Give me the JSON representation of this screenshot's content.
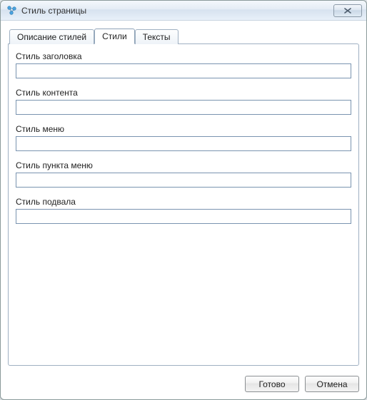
{
  "window": {
    "title": "Стиль страницы"
  },
  "tabs": [
    {
      "label": "Описание стилей",
      "active": false
    },
    {
      "label": "Стили",
      "active": true
    },
    {
      "label": "Тексты",
      "active": false
    }
  ],
  "fields": {
    "title_style": {
      "label": "Стиль заголовка",
      "value": ""
    },
    "content_style": {
      "label": "Стиль контента",
      "value": ""
    },
    "menu_style": {
      "label": "Стиль меню",
      "value": ""
    },
    "menuitem_style": {
      "label": "Стиль пункта меню",
      "value": ""
    },
    "footer_style": {
      "label": "Стиль подвала",
      "value": ""
    }
  },
  "footer": {
    "ok_label": "Готово",
    "cancel_label": "Отмена"
  }
}
